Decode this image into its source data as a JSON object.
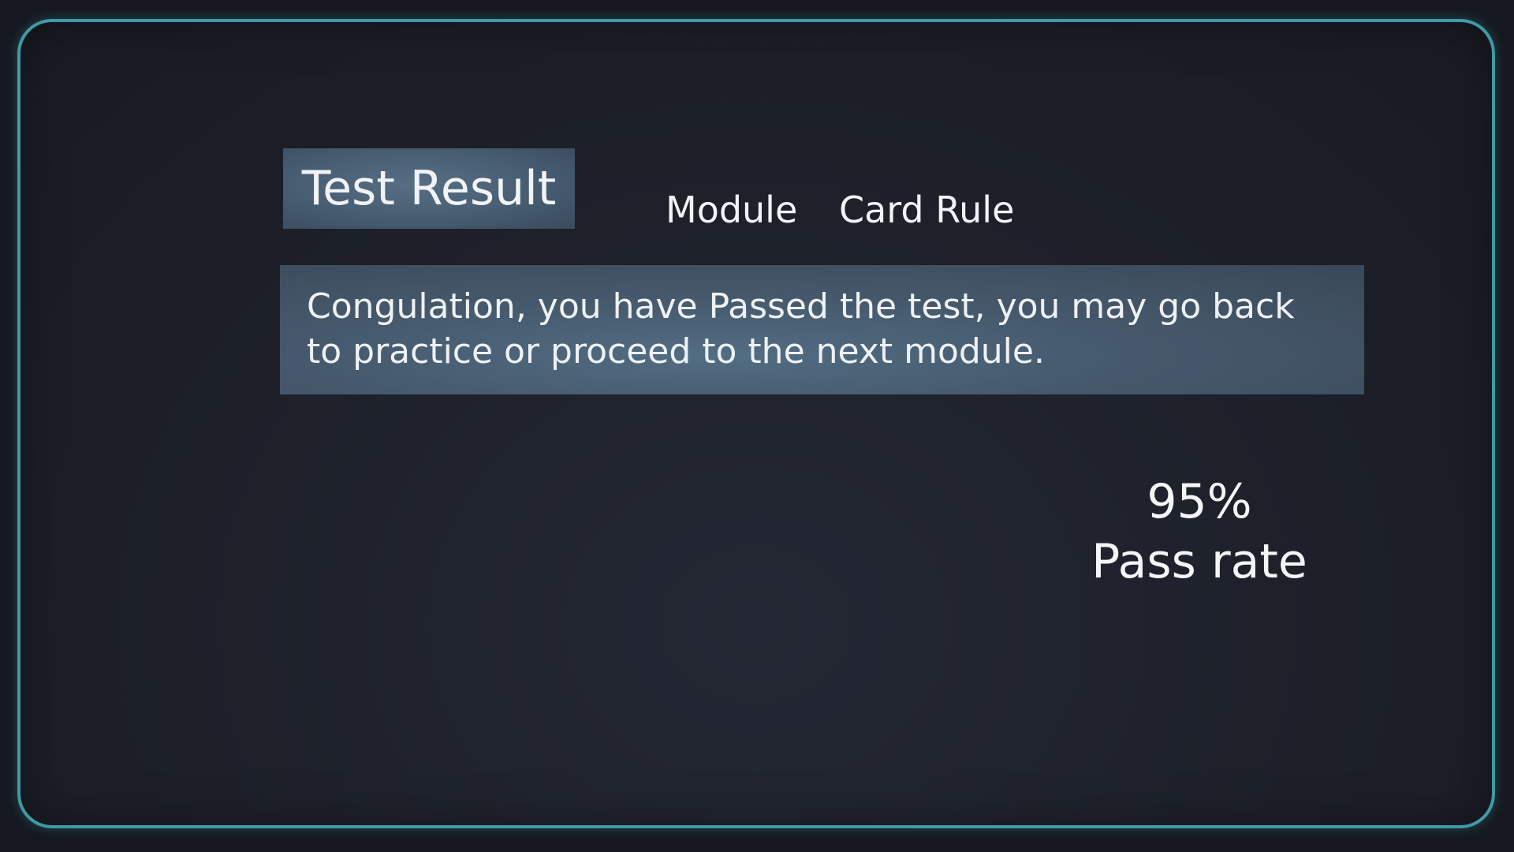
{
  "tabs": {
    "test_result": "Test Result",
    "module": "Module",
    "card_rule": "Card Rule"
  },
  "message": "Congulation, you have Passed the test, you may go back to practice or proceed to the next module.",
  "result": {
    "percentage": "95%",
    "label": "Pass rate"
  },
  "colors": {
    "frame_border": "#3f9aa6",
    "panel_accent": "#4a6075",
    "background": "#1d2029"
  }
}
